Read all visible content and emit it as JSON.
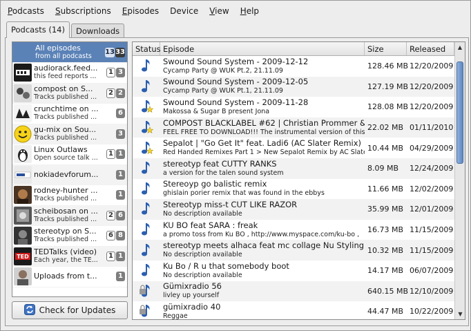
{
  "menu": [
    {
      "key": "P",
      "rest": "odcasts"
    },
    {
      "key": "S",
      "rest": "ubscriptions"
    },
    {
      "key": "E",
      "rest": "pisodes"
    },
    {
      "key": "",
      "rest": "Device"
    },
    {
      "key": "V",
      "rest": "iew"
    },
    {
      "key": "H",
      "rest": "elp"
    }
  ],
  "tabs": {
    "podcasts": "Podcasts (14)",
    "downloads": "Downloads"
  },
  "podcasts": {
    "all": {
      "title": "All episodes",
      "subtitle": "from all podcasts",
      "c1": "13",
      "c2": "33"
    },
    "items": [
      {
        "title": "audiorack.feed...",
        "subtitle": "this feed reports ...",
        "c1": "1",
        "c2": "3",
        "cover": "audiorack"
      },
      {
        "title": "compost on S...",
        "subtitle": "Tracks published ...",
        "c1": "2",
        "c2": "2",
        "cover": "compost"
      },
      {
        "title": "crunchtime on ...",
        "subtitle": "Tracks published ...",
        "c1": "",
        "c2": "6",
        "cover": "crunchtime"
      },
      {
        "title": "gu-mix on Sou...",
        "subtitle": "Tracks published ...",
        "c1": "",
        "c2": "3",
        "cover": "smiley"
      },
      {
        "title": "Linux Outlaws",
        "subtitle": "Open source talk ...",
        "c1": "1",
        "c2": "1",
        "cover": "linux"
      },
      {
        "title": "nokiadevforum...",
        "subtitle": "",
        "c1": "",
        "c2": "1",
        "cover": "nokia"
      },
      {
        "title": "rodney-hunter ...",
        "subtitle": "Tracks published ...",
        "c1": "",
        "c2": "1",
        "cover": "rodney"
      },
      {
        "title": "scheibosan on ...",
        "subtitle": "Tracks published ...",
        "c1": "2",
        "c2": "6",
        "cover": "scheibosan"
      },
      {
        "title": "stereotyp on S...",
        "subtitle": "Tracks published ...",
        "c1": "6",
        "c2": "8",
        "cover": "stereotyp"
      },
      {
        "title": "TEDTalks (video)",
        "subtitle": "Each year, the TE...",
        "c1": "1",
        "c2": "1",
        "cover": "ted"
      },
      {
        "title": "Uploads from t...",
        "subtitle": "",
        "c1": "",
        "c2": "1",
        "cover": "uploads"
      }
    ]
  },
  "check_updates": "Check for Updates",
  "episode_headers": {
    "status": "Status",
    "episode": "Episode",
    "size": "Size",
    "released": "Released"
  },
  "episodes": [
    {
      "title": "Swound Sound System - 2009-12-12",
      "desc": "Cycamp Party @ WUK Pt.2, 21.11.09",
      "size": "128.46 MB",
      "released": "12/20/2009",
      "status": "new"
    },
    {
      "title": "Swound Sound System - 2009-12-05",
      "desc": "Cycamp Party @ WUK Pt.1, 21.11.09",
      "size": "127.19 MB",
      "released": "12/20/2009",
      "status": "new"
    },
    {
      "title": "Swound Sound System - 2009-11-28",
      "desc": "Makossa & Sugar B present Jona",
      "size": "128.08 MB",
      "released": "12/20/2009",
      "status": "new-star"
    },
    {
      "title": "COMPOST BLACKLABEL #62 | Christian Prommer & T...",
      "desc": "FEEL FREE TO DOWNLOAD!!! The instrumental version of this tr...",
      "size": "22.02 MB",
      "released": "01/11/2010",
      "status": "new-star"
    },
    {
      "title": "Sepalot | \"Go Get It\" feat. Ladi6 (AC Slater Remix)",
      "desc": "Red Handed Remixes Part 1 > New Sepalot Remix by AC Slater...",
      "size": "10.44 MB",
      "released": "04/29/2009",
      "status": "new-star"
    },
    {
      "title": "stereotyp feat CUTTY RANKS",
      "desc": "a version for the talen sound system",
      "size": "8.09 MB",
      "released": "12/24/2009",
      "status": "new"
    },
    {
      "title": "Stereoyp go balistic remix",
      "desc": "ghislain porier remix that was found in the ebbys",
      "size": "11.66 MB",
      "released": "12/02/2009",
      "status": "new"
    },
    {
      "title": "Stereotyp miss-t CUT LIKE RAZOR",
      "desc": "No description available",
      "size": "35.99 MB",
      "released": "12/01/2009",
      "status": "new"
    },
    {
      "title": " KU BO feat SARA :  freak",
      "desc": "a promo toss from Ku BO ,   http://www.myspace.com/ku-bo ,",
      "size": "16.73 MB",
      "released": "11/15/2009",
      "status": "new"
    },
    {
      "title": "stereotyp meets alhaca feat mc collage Nu Styling",
      "desc": "No description available",
      "size": "10.32 MB",
      "released": "11/15/2009",
      "status": "new"
    },
    {
      "title": "Ku Bo  /  R u that somebody boot",
      "desc": "No description available",
      "size": "14.17 MB",
      "released": "06/07/2009",
      "status": "new"
    },
    {
      "title": "Gümixradio 56",
      "desc": "livley up yourself",
      "size": "640.15 MB",
      "released": "12/10/2009",
      "status": "locked"
    },
    {
      "title": "gümixradio 40",
      "desc": "Reggae",
      "size": "44.47 MB",
      "released": "10/22/2009",
      "status": "locked"
    }
  ]
}
